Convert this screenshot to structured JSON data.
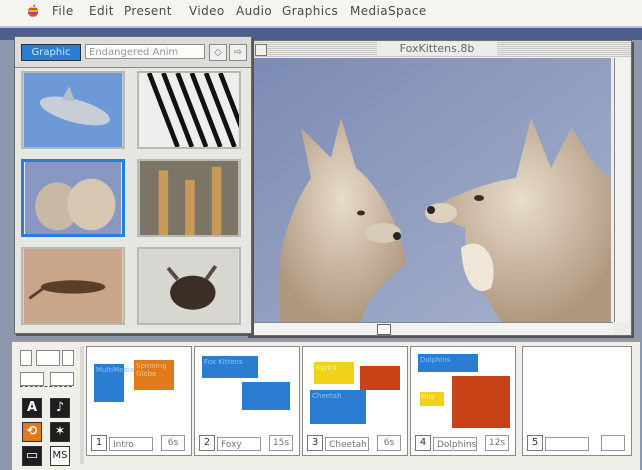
{
  "menubar": {
    "items": [
      "File",
      "Edit",
      "Present",
      "Video",
      "Audio",
      "Graphics",
      "MediaSpace"
    ]
  },
  "browser": {
    "category": "Graphic",
    "search_value": "Endangered Anim",
    "thumbnails": [
      "dolphin",
      "zebra",
      "fox-kittens",
      "giraffes",
      "cheetah",
      "moose"
    ]
  },
  "main_window": {
    "title": "FoxKittens.8b"
  },
  "tools": {
    "text_tool": "A",
    "ms_label": "MS"
  },
  "storyboard": {
    "cards": [
      {
        "number": "1",
        "name": "Intro",
        "duration": "6s",
        "shapes": [
          {
            "color": "#2a7dd0",
            "text": "MultiMedia"
          },
          {
            "color": "#e07a1a",
            "text": "Spinning Globe"
          }
        ]
      },
      {
        "number": "2",
        "name": "Foxy",
        "duration": "15s",
        "shapes": [
          {
            "color": "#2a7dd0",
            "text": "Fox Kittens"
          },
          {
            "color": "#2a7dd0",
            "text": ""
          }
        ]
      },
      {
        "number": "3",
        "name": "Cheetah",
        "duration": "6s",
        "shapes": [
          {
            "color": "#f0d21a",
            "text": "Sprint"
          },
          {
            "color": "#c84218",
            "text": ""
          },
          {
            "color": "#2a7dd0",
            "text": "Cheetah"
          }
        ]
      },
      {
        "number": "4",
        "name": "Dolphins",
        "duration": "12s",
        "shapes": [
          {
            "color": "#2a7dd0",
            "text": "Dolphins"
          },
          {
            "color": "#f0d21a",
            "text": "Fins"
          },
          {
            "color": "#c84218",
            "text": ""
          }
        ]
      },
      {
        "number": "5",
        "name": "",
        "duration": "",
        "shapes": []
      }
    ]
  },
  "colors": {
    "accent": "#2a7dd0",
    "orange": "#e07a1a",
    "red": "#c84218",
    "yellow": "#f0d21a"
  }
}
